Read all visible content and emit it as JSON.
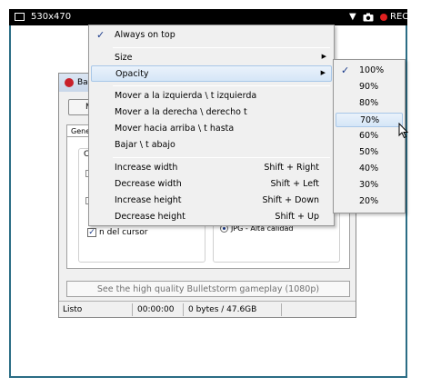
{
  "capture_bar": {
    "size": "530x470",
    "rec": "REC",
    "icons": [
      "window-icon",
      "dropdown-arrow-icon",
      "camera-icon",
      "record-dot-icon"
    ]
  },
  "app": {
    "title_fragment": "Ba",
    "button_fragment": "M",
    "tab_fragment": "Gene",
    "ghost_letter": "C",
    "cursor_checkbox_label": "n del cursor",
    "format_radio_label": "JPG - Alta calidad",
    "banner": "See the high quality Bulletstorm gameplay (1080p)",
    "status": {
      "state": "Listo",
      "time": "00:00:00",
      "size": "0 bytes / 47.6GB"
    }
  },
  "menu": {
    "items": [
      {
        "label": "Always on top",
        "checked": true
      },
      {
        "label": "Size",
        "submenu": true
      },
      {
        "label": "Opacity",
        "submenu": true,
        "highlighted": true
      },
      {
        "label": "Mover a la izquierda \\ t izquierda"
      },
      {
        "label": "Mover a la derecha \\ derecho t"
      },
      {
        "label": "Mover hacia arriba \\ t hasta"
      },
      {
        "label": "Bajar \\ t abajo"
      },
      {
        "label": "Increase width",
        "shortcut": "Shift + Right"
      },
      {
        "label": "Decrease width",
        "shortcut": "Shift + Left"
      },
      {
        "label": "Increase height",
        "shortcut": "Shift + Down"
      },
      {
        "label": "Decrease height",
        "shortcut": "Shift + Up"
      }
    ]
  },
  "opacity_menu": {
    "items": [
      {
        "label": "100%",
        "checked": true
      },
      {
        "label": "90%"
      },
      {
        "label": "80%"
      },
      {
        "label": "70%",
        "highlighted": true
      },
      {
        "label": "60%"
      },
      {
        "label": "50%"
      },
      {
        "label": "40%"
      },
      {
        "label": "30%"
      },
      {
        "label": "20%"
      }
    ]
  },
  "colors": {
    "frame": "#2b6d85",
    "bar": "#000000",
    "rec": "#e02020",
    "highlight": "#d5e6f7"
  }
}
